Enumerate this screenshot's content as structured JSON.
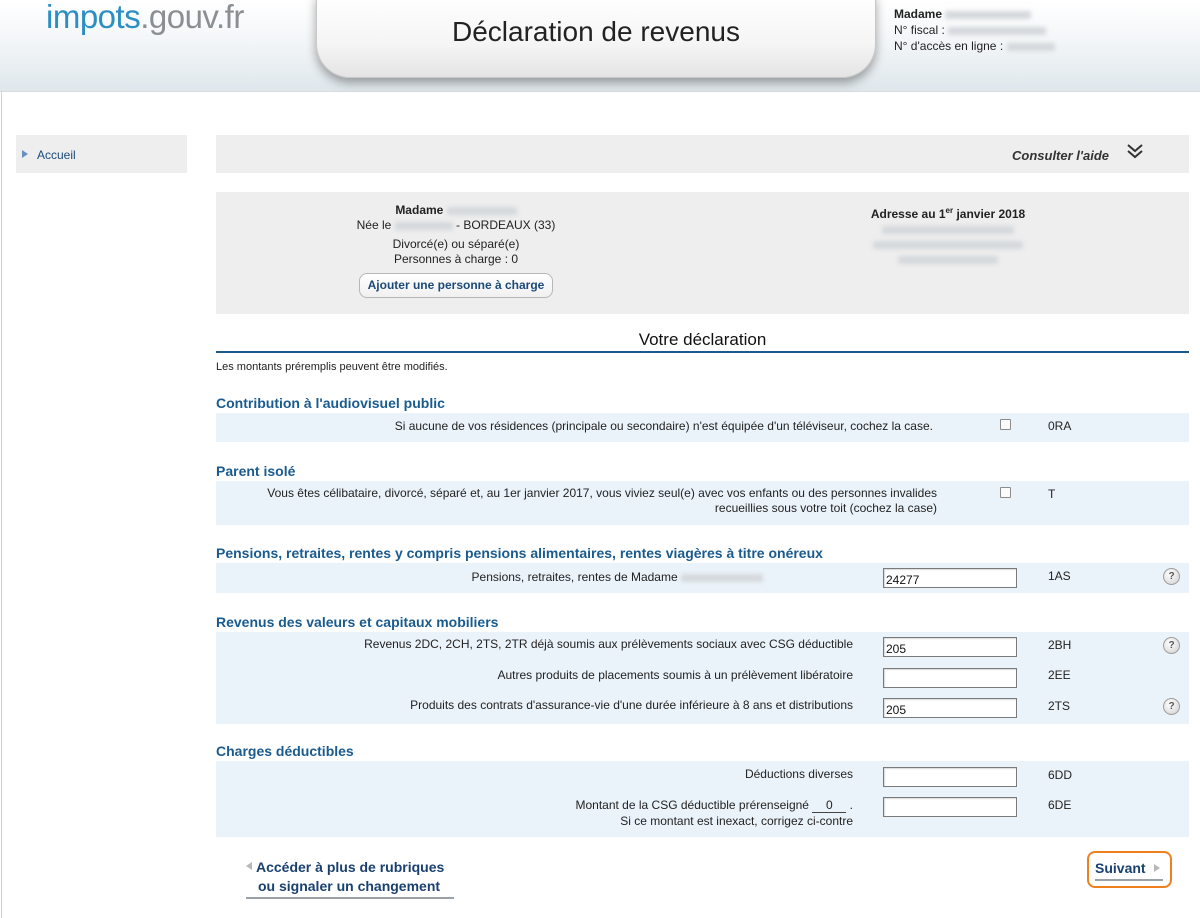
{
  "header": {
    "logo_main": "impots",
    "logo_tld": ".gouv.fr",
    "title": "Déclaration de revenus",
    "user_title": "Madame",
    "fiscal_label": "N° fiscal :",
    "access_label": "N° d'accès en ligne :"
  },
  "sidebar": {
    "items": [
      {
        "label": "Accueil"
      }
    ]
  },
  "help": {
    "label": "Consulter l'aide",
    "icon": "double-chevron-down-icon"
  },
  "identity": {
    "name_prefix": "Madame",
    "born_prefix": "Née le",
    "born_place": "- BORDEAUX (33)",
    "status": "Divorcé(e) ou séparé(e)",
    "dependents": "Personnes à charge : 0",
    "add_dependent_button": "Ajouter une personne à charge",
    "address_title_pre": "Adresse au 1",
    "address_title_sup": "er",
    "address_title_post": " janvier 2018"
  },
  "declaration": {
    "title": "Votre déclaration",
    "note": "Les montants préremplis peuvent être modifiés.",
    "sections": [
      {
        "title": "Contribution à l'audiovisuel public",
        "rows": [
          {
            "label": "Si aucune de vos résidences (principale ou secondaire) n'est équipée d'un téléviseur, cochez la case.",
            "type": "checkbox",
            "code": "0RA"
          }
        ]
      },
      {
        "title": "Parent isolé",
        "rows": [
          {
            "label_line1": "Vous êtes célibataire, divorcé, séparé et, au 1er janvier 2017, vous viviez seul(e) avec vos enfants ou des personnes invalides",
            "label_line2": "recueillies sous votre toit (cochez la case)",
            "type": "checkbox",
            "code": "T"
          }
        ]
      },
      {
        "title": "Pensions, retraites, rentes y compris pensions alimentaires, rentes viagères à titre onéreux",
        "rows": [
          {
            "label": "Pensions, retraites, rentes de Madame",
            "type": "input",
            "value": "24277",
            "code": "1AS",
            "help": true
          }
        ]
      },
      {
        "title": "Revenus des valeurs et capitaux mobiliers",
        "rows": [
          {
            "label": "Revenus 2DC, 2CH, 2TS, 2TR déjà soumis aux prélèvements sociaux avec CSG déductible",
            "type": "input",
            "value": "205",
            "code": "2BH",
            "help": true
          },
          {
            "label": "Autres produits de placements soumis à un prélèvement libératoire",
            "type": "input",
            "value": "",
            "code": "2EE",
            "help": false
          },
          {
            "label": "Produits des contrats d'assurance-vie d'une durée inférieure à 8 ans et distributions",
            "type": "input",
            "value": "205",
            "code": "2TS",
            "help": true
          }
        ]
      },
      {
        "title": "Charges déductibles",
        "rows": [
          {
            "label": "Déductions diverses",
            "type": "input",
            "value": "",
            "code": "6DD",
            "help": false
          },
          {
            "label_pre": "Montant de la CSG déductible prérenseigné",
            "prefilled": "0",
            "label_post": ".",
            "label_line2": "Si ce montant est inexact, corrigez ci-contre",
            "type": "input",
            "value": "",
            "code": "6DE",
            "help": false
          }
        ]
      }
    ]
  },
  "nav": {
    "more_line1": "Accéder à plus de rubriques",
    "more_line2": "ou signaler un changement",
    "next": "Suivant"
  },
  "colors": {
    "section_title": "#1a5b8f",
    "band": "#ebf3fa",
    "next_border": "#f0801e",
    "logo": "#2b8fc4"
  }
}
